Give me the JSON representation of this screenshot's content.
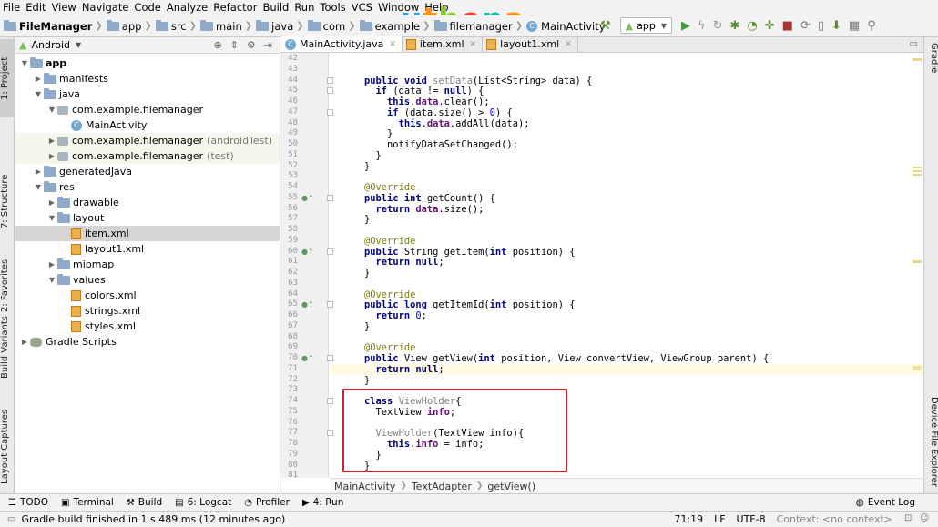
{
  "menu": [
    "File",
    "Edit",
    "View",
    "Navigate",
    "Code",
    "Analyze",
    "Refactor",
    "Build",
    "Run",
    "Tools",
    "VCS",
    "Window",
    "Help"
  ],
  "logo": {
    "text": "uthena",
    "letters": [
      "u",
      "t",
      "h",
      "e",
      "n",
      "a"
    ],
    "colors": [
      "#27a9e1",
      "#f7941d",
      "#8dc63f",
      "#ef4136",
      "#1fb9a8",
      "#f7941d"
    ]
  },
  "breadcrumb": [
    "FileManager",
    "app",
    "src",
    "main",
    "java",
    "com",
    "example",
    "filemanager",
    "MainActivity"
  ],
  "run_config": "app",
  "left_tabs": {
    "project": "1: Project",
    "structure": "7: Structure",
    "favorites": "2: Favorites",
    "build_variants": "Build Variants",
    "layout_captures": "Layout Captures"
  },
  "right_tabs": {
    "gradle": "Gradle",
    "device_explorer": "Device File Explorer"
  },
  "project_panel": {
    "view": "Android"
  },
  "tree": [
    {
      "label": "app",
      "note": "",
      "indent": 0,
      "arrow": "▼",
      "icon": "folder",
      "bold": true
    },
    {
      "label": "manifests",
      "note": "",
      "indent": 1,
      "arrow": "▶",
      "icon": "folder"
    },
    {
      "label": "java",
      "note": "",
      "indent": 1,
      "arrow": "▼",
      "icon": "folder"
    },
    {
      "label": "com.example.filemanager",
      "note": "",
      "indent": 2,
      "arrow": "▼",
      "icon": "pkg"
    },
    {
      "label": "MainActivity",
      "note": "",
      "indent": 3,
      "arrow": "",
      "icon": "java"
    },
    {
      "label": "com.example.filemanager",
      "note": "(androidTest)",
      "indent": 2,
      "arrow": "▶",
      "icon": "pkg",
      "test": true
    },
    {
      "label": "com.example.filemanager",
      "note": "(test)",
      "indent": 2,
      "arrow": "▶",
      "icon": "pkg",
      "test": true
    },
    {
      "label": "generatedJava",
      "note": "",
      "indent": 1,
      "arrow": "▶",
      "icon": "folder"
    },
    {
      "label": "res",
      "note": "",
      "indent": 1,
      "arrow": "▼",
      "icon": "folder"
    },
    {
      "label": "drawable",
      "note": "",
      "indent": 2,
      "arrow": "▶",
      "icon": "folder"
    },
    {
      "label": "layout",
      "note": "",
      "indent": 2,
      "arrow": "▼",
      "icon": "folder"
    },
    {
      "label": "item.xml",
      "note": "",
      "indent": 3,
      "arrow": "",
      "icon": "xml",
      "selected": true
    },
    {
      "label": "layout1.xml",
      "note": "",
      "indent": 3,
      "arrow": "",
      "icon": "xml"
    },
    {
      "label": "mipmap",
      "note": "",
      "indent": 2,
      "arrow": "▶",
      "icon": "folder"
    },
    {
      "label": "values",
      "note": "",
      "indent": 2,
      "arrow": "▼",
      "icon": "folder"
    },
    {
      "label": "colors.xml",
      "note": "",
      "indent": 3,
      "arrow": "",
      "icon": "xml"
    },
    {
      "label": "strings.xml",
      "note": "",
      "indent": 3,
      "arrow": "",
      "icon": "xml"
    },
    {
      "label": "styles.xml",
      "note": "",
      "indent": 3,
      "arrow": "",
      "icon": "xml"
    },
    {
      "label": "Gradle Scripts",
      "note": "",
      "indent": 0,
      "arrow": "▶",
      "icon": "gradle"
    }
  ],
  "editor_tabs": [
    {
      "label": "MainActivity.java",
      "icon": "java",
      "active": true
    },
    {
      "label": "item.xml",
      "icon": "xml",
      "active": false
    },
    {
      "label": "layout1.xml",
      "icon": "xml",
      "active": false
    }
  ],
  "code_lines": [
    {
      "n": "42",
      "segs": []
    },
    {
      "n": "43",
      "segs": []
    },
    {
      "n": "44",
      "segs": [
        [
          "    ",
          ""
        ],
        [
          "public void ",
          "kw"
        ],
        [
          "setData",
          "unused"
        ],
        [
          "(List<String> data) {",
          ""
        ]
      ]
    },
    {
      "n": "45",
      "segs": [
        [
          "      ",
          ""
        ],
        [
          "if ",
          "kw"
        ],
        [
          "(data != ",
          ""
        ],
        [
          "null",
          "kw"
        ],
        [
          ") {",
          ""
        ]
      ]
    },
    {
      "n": "46",
      "segs": [
        [
          "        ",
          ""
        ],
        [
          "this",
          "kw"
        ],
        [
          ".",
          ""
        ],
        [
          "data",
          "fld"
        ],
        [
          ".clear();",
          ""
        ]
      ]
    },
    {
      "n": "47",
      "segs": [
        [
          "        ",
          ""
        ],
        [
          "if ",
          "kw"
        ],
        [
          "(data.size() > ",
          ""
        ],
        [
          "0",
          "num"
        ],
        [
          ") {",
          ""
        ]
      ]
    },
    {
      "n": "48",
      "segs": [
        [
          "          ",
          ""
        ],
        [
          "this",
          "kw"
        ],
        [
          ".",
          ""
        ],
        [
          "data",
          "fld"
        ],
        [
          ".addAll(data);",
          ""
        ]
      ]
    },
    {
      "n": "49",
      "segs": [
        [
          "        }",
          ""
        ]
      ]
    },
    {
      "n": "50",
      "segs": [
        [
          "        notifyDataSetChanged();",
          ""
        ]
      ]
    },
    {
      "n": "51",
      "segs": [
        [
          "      }",
          ""
        ]
      ]
    },
    {
      "n": "52",
      "segs": [
        [
          "    }",
          ""
        ]
      ]
    },
    {
      "n": "53",
      "segs": []
    },
    {
      "n": "54",
      "segs": [
        [
          "    ",
          ""
        ],
        [
          "@Override",
          "ann"
        ]
      ]
    },
    {
      "n": "55",
      "segs": [
        [
          "    ",
          ""
        ],
        [
          "public int ",
          "kw"
        ],
        [
          "getCount() {",
          ""
        ]
      ],
      "mark": true
    },
    {
      "n": "56",
      "segs": [
        [
          "      ",
          ""
        ],
        [
          "return ",
          "kw"
        ],
        [
          "data",
          "fld"
        ],
        [
          ".size();",
          ""
        ]
      ]
    },
    {
      "n": "57",
      "segs": [
        [
          "    }",
          ""
        ]
      ]
    },
    {
      "n": "58",
      "segs": []
    },
    {
      "n": "59",
      "segs": [
        [
          "    ",
          ""
        ],
        [
          "@Override",
          "ann"
        ]
      ]
    },
    {
      "n": "60",
      "segs": [
        [
          "    ",
          ""
        ],
        [
          "public ",
          "kw"
        ],
        [
          "String getItem(",
          ""
        ],
        [
          "int ",
          "kw"
        ],
        [
          "position) {",
          ""
        ]
      ],
      "mark": true
    },
    {
      "n": "61",
      "segs": [
        [
          "      ",
          ""
        ],
        [
          "return null",
          "kw"
        ],
        [
          ";",
          ""
        ]
      ]
    },
    {
      "n": "62",
      "segs": [
        [
          "    }",
          ""
        ]
      ]
    },
    {
      "n": "63",
      "segs": []
    },
    {
      "n": "64",
      "segs": [
        [
          "    ",
          ""
        ],
        [
          "@Override",
          "ann"
        ]
      ]
    },
    {
      "n": "65",
      "segs": [
        [
          "    ",
          ""
        ],
        [
          "public long ",
          "kw"
        ],
        [
          "getItemId(",
          ""
        ],
        [
          "int ",
          "kw"
        ],
        [
          "position) {",
          ""
        ]
      ],
      "mark": true
    },
    {
      "n": "66",
      "segs": [
        [
          "      ",
          ""
        ],
        [
          "return ",
          "kw"
        ],
        [
          "0",
          "num"
        ],
        [
          ";",
          ""
        ]
      ]
    },
    {
      "n": "67",
      "segs": [
        [
          "    }",
          ""
        ]
      ]
    },
    {
      "n": "68",
      "segs": []
    },
    {
      "n": "69",
      "segs": [
        [
          "    ",
          ""
        ],
        [
          "@Override",
          "ann"
        ]
      ]
    },
    {
      "n": "70",
      "segs": [
        [
          "    ",
          ""
        ],
        [
          "public ",
          "kw"
        ],
        [
          "View getView(",
          ""
        ],
        [
          "int ",
          "kw"
        ],
        [
          "position, View convertView, ViewGroup parent) {",
          ""
        ]
      ],
      "mark": true
    },
    {
      "n": "71",
      "segs": [
        [
          "      ",
          ""
        ],
        [
          "return null",
          "kw"
        ],
        [
          ";",
          ""
        ]
      ],
      "current": true
    },
    {
      "n": "72",
      "segs": [
        [
          "    }",
          ""
        ]
      ]
    },
    {
      "n": "73",
      "segs": []
    },
    {
      "n": "74",
      "segs": [
        [
          "    ",
          ""
        ],
        [
          "class ",
          "kw"
        ],
        [
          "ViewHolder",
          "unused"
        ],
        [
          "{",
          ""
        ]
      ]
    },
    {
      "n": "75",
      "segs": [
        [
          "      TextView ",
          ""
        ],
        [
          "info",
          "fld"
        ],
        [
          ";",
          ""
        ]
      ]
    },
    {
      "n": "76",
      "segs": []
    },
    {
      "n": "77",
      "segs": [
        [
          "      ",
          ""
        ],
        [
          "ViewHolder",
          "unused"
        ],
        [
          "(TextView info){",
          ""
        ]
      ]
    },
    {
      "n": "78",
      "segs": [
        [
          "        ",
          ""
        ],
        [
          "this",
          "kw"
        ],
        [
          ".",
          ""
        ],
        [
          "info",
          "fld"
        ],
        [
          " = info;",
          ""
        ]
      ]
    },
    {
      "n": "79",
      "segs": [
        [
          "      }",
          ""
        ]
      ]
    },
    {
      "n": "80",
      "segs": [
        [
          "    }",
          ""
        ]
      ]
    },
    {
      "n": "81",
      "segs": []
    }
  ],
  "editor_breadcrumb": [
    "MainActivity",
    "TextAdapter",
    "getView()"
  ],
  "tool_windows": [
    {
      "label": "TODO",
      "icon": "☰"
    },
    {
      "label": "Terminal",
      "icon": "▣"
    },
    {
      "label": "Build",
      "icon": "⚒"
    },
    {
      "label": "6: Logcat",
      "icon": "▤"
    },
    {
      "label": "Profiler",
      "icon": "◔"
    },
    {
      "label": "4: Run",
      "icon": "▶"
    }
  ],
  "event_log": "Event Log",
  "status": {
    "message": "Gradle build finished in 1 s 489 ms (12 minutes ago)",
    "position": "71:19",
    "line_sep": "LF",
    "encoding": "UTF-8",
    "context": "Context: <no context>"
  }
}
